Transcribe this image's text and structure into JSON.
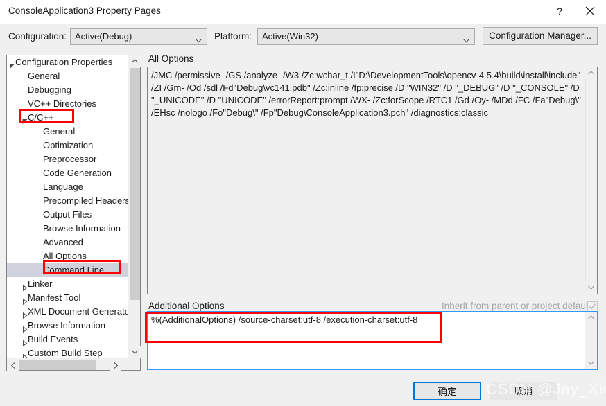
{
  "window": {
    "title": "ConsoleApplication3 Property Pages",
    "help_glyph": "?",
    "close_glyph": "×"
  },
  "config_row": {
    "configuration_label": "Configuration:",
    "configuration_value": "Active(Debug)",
    "platform_label": "Platform:",
    "platform_value": "Active(Win32)",
    "configuration_manager_button": "Configuration Manager..."
  },
  "tree": {
    "nodes": [
      {
        "label": "Configuration Properties",
        "indent": 0,
        "glyph": "expanded",
        "selected": false
      },
      {
        "label": "General",
        "indent": 1,
        "glyph": "none",
        "selected": false
      },
      {
        "label": "Debugging",
        "indent": 1,
        "glyph": "none",
        "selected": false
      },
      {
        "label": "VC++ Directories",
        "indent": 1,
        "glyph": "none",
        "selected": false
      },
      {
        "label": "C/C++",
        "indent": 1,
        "glyph": "expanded",
        "selected": false
      },
      {
        "label": "General",
        "indent": 2,
        "glyph": "none",
        "selected": false
      },
      {
        "label": "Optimization",
        "indent": 2,
        "glyph": "none",
        "selected": false
      },
      {
        "label": "Preprocessor",
        "indent": 2,
        "glyph": "none",
        "selected": false
      },
      {
        "label": "Code Generation",
        "indent": 2,
        "glyph": "none",
        "selected": false
      },
      {
        "label": "Language",
        "indent": 2,
        "glyph": "none",
        "selected": false
      },
      {
        "label": "Precompiled Headers",
        "indent": 2,
        "glyph": "none",
        "selected": false
      },
      {
        "label": "Output Files",
        "indent": 2,
        "glyph": "none",
        "selected": false
      },
      {
        "label": "Browse Information",
        "indent": 2,
        "glyph": "none",
        "selected": false
      },
      {
        "label": "Advanced",
        "indent": 2,
        "glyph": "none",
        "selected": false
      },
      {
        "label": "All Options",
        "indent": 2,
        "glyph": "none",
        "selected": false
      },
      {
        "label": "Command Line",
        "indent": 2,
        "glyph": "none",
        "selected": true
      },
      {
        "label": "Linker",
        "indent": 1,
        "glyph": "collapsed",
        "selected": false
      },
      {
        "label": "Manifest Tool",
        "indent": 1,
        "glyph": "collapsed",
        "selected": false
      },
      {
        "label": "XML Document Generator",
        "indent": 1,
        "glyph": "collapsed",
        "selected": false
      },
      {
        "label": "Browse Information",
        "indent": 1,
        "glyph": "collapsed",
        "selected": false
      },
      {
        "label": "Build Events",
        "indent": 1,
        "glyph": "collapsed",
        "selected": false
      },
      {
        "label": "Custom Build Step",
        "indent": 1,
        "glyph": "collapsed",
        "selected": false
      }
    ]
  },
  "all_options": {
    "label": "All Options",
    "value": "/JMC /permissive- /GS /analyze- /W3 /Zc:wchar_t /I\"D:\\DevelopmentTools\\opencv-4.5.4\\build\\install\\include\" /ZI /Gm- /Od /sdl /Fd\"Debug\\vc141.pdb\" /Zc:inline /fp:precise /D \"WIN32\" /D \"_DEBUG\" /D \"_CONSOLE\" /D \"_UNICODE\" /D \"UNICODE\" /errorReport:prompt /WX- /Zc:forScope /RTC1 /Gd /Oy- /MDd /FC /Fa\"Debug\\\" /EHsc /nologo /Fo\"Debug\\\" /Fp\"Debug\\ConsoleApplication3.pch\" /diagnostics:classic"
  },
  "additional_options": {
    "label": "Additional Options",
    "value": "%(AdditionalOptions) /source-charset:utf-8 /execution-charset:utf-8",
    "inherit_label": "Inherit from parent or project defaults",
    "inherit_checked": true
  },
  "footer": {
    "ok_label": "确定",
    "cancel_label": "取消"
  },
  "watermark": {
    "text": "CSDN @Jay_Xio"
  },
  "colors": {
    "accent": "#0078d7",
    "annotation": "#ff0000",
    "dialog_bg": "#f0f0f0",
    "selection": "#cfd2dd"
  }
}
